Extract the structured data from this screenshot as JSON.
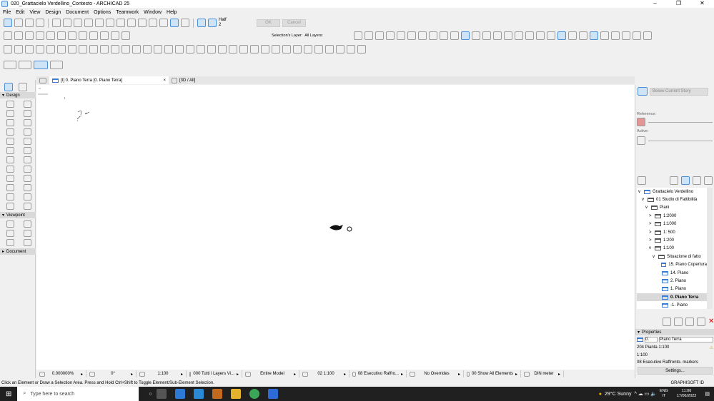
{
  "window": {
    "title": "020_Grattacielo Verdellino_Contesto - ARCHICAD 25",
    "min": "–",
    "max": "❐",
    "close": "✕"
  },
  "menu": [
    "File",
    "Edit",
    "View",
    "Design",
    "Document",
    "Options",
    "Teamwork",
    "Window",
    "Help"
  ],
  "toolbar": {
    "half_label": "Half",
    "half_value": "2",
    "ok": "OK",
    "cancel": "Cancel",
    "selection_layer": "Selection's Layer:",
    "all_layers": "All Layers:"
  },
  "tabs": [
    {
      "label": "[I] 0. Piano Terra [0. Piano Terra]",
      "close": "×"
    },
    {
      "label": "[3D / All]"
    }
  ],
  "toolbox": {
    "design": "Design",
    "viewpoint": "Viewpoint",
    "document": "Document"
  },
  "right": {
    "below_story": "Below Current Story",
    "reference": "Reference:",
    "active": "Active:",
    "tree": [
      {
        "label": "Grattacielo Verdellino",
        "level": 0,
        "arrow": "v"
      },
      {
        "label": "01 Studio di Fattibilità",
        "level": 1,
        "arrow": "v"
      },
      {
        "label": "Piani",
        "level": 2,
        "arrow": "v"
      },
      {
        "label": "1:2000",
        "level": 3,
        "arrow": ">"
      },
      {
        "label": "1:1000",
        "level": 3,
        "arrow": ">"
      },
      {
        "label": "1: 500",
        "level": 3,
        "arrow": ">"
      },
      {
        "label": "1:200",
        "level": 3,
        "arrow": ">"
      },
      {
        "label": "1:100",
        "level": 3,
        "arrow": "v"
      },
      {
        "label": "Situazione di fatto",
        "level": 4,
        "arrow": "v"
      },
      {
        "label": "15. Piano Copertura",
        "level": 5,
        "arrow": ""
      },
      {
        "label": "14. Piano",
        "level": 5,
        "arrow": ""
      },
      {
        "label": "2. Piano",
        "level": 5,
        "arrow": ""
      },
      {
        "label": "1. Piano",
        "level": 5,
        "arrow": ""
      },
      {
        "label": "0. Piano Terra",
        "level": 5,
        "arrow": "",
        "selected": true
      },
      {
        "label": "-1. Piano",
        "level": 5,
        "arrow": ""
      }
    ],
    "properties": {
      "title": "Properties",
      "id": "0.",
      "name": "Piano Terra",
      "view": "204 Pianta 1:100",
      "scale": "1:100",
      "markers": "08 Esecutivo Raffronto- markers",
      "settings": "Settings..."
    }
  },
  "status": [
    {
      "label": "0.000000%"
    },
    {
      "label": "0°"
    },
    {
      "label": "1:100"
    },
    {
      "label": "000 Tutti i Layers Vi..."
    },
    {
      "label": "Entire Model"
    },
    {
      "label": "02 1:100"
    },
    {
      "label": "08 Esecutivo Raffro..."
    },
    {
      "label": "No Overrides"
    },
    {
      "label": "00 Show All Elements"
    },
    {
      "label": "DIN meter"
    }
  ],
  "message": "Click an Element or Draw a Selection Area. Press and Hold Ctrl+Shift to Toggle Element/Sub-Element Selection.",
  "brand": "GRAPHISOFT ID",
  "taskbar": {
    "search": "Type here to search",
    "weather": "29°C  Sunny",
    "lang": "ENG",
    "region": "IT",
    "time": "11:06",
    "date": "17/06/2022"
  }
}
